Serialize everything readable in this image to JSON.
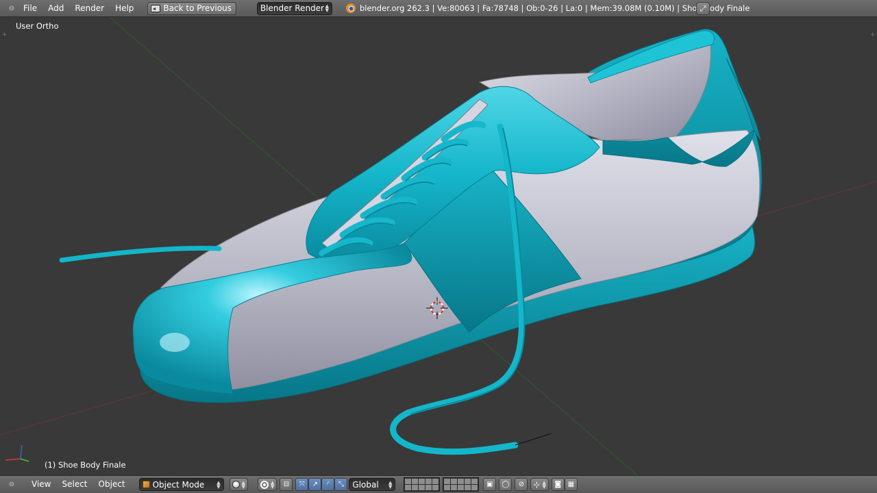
{
  "top_header": {
    "menus": [
      "File",
      "Add",
      "Render",
      "Help"
    ],
    "back_button_label": "Back to Previous",
    "render_engine": "Blender Render",
    "stats": "blender.org 262.3 | Ve:80063 | Fa:78748 | Ob:0-26 | La:0 | Mem:39.08M (0.10M) | Shoe Body Finale"
  },
  "viewport": {
    "view_name": "User Ortho",
    "active_object": "(1) Shoe Body Finale",
    "model_colors": {
      "accent": "#12b8cc",
      "accent_dark": "#0a8fa3",
      "panel": "#c9cad6",
      "lining": "#b8b8c8"
    }
  },
  "bottom_header": {
    "menus": [
      "View",
      "Select",
      "Object"
    ],
    "mode": "Object Mode",
    "orientation": "Global"
  },
  "icons": {
    "toggle": "header-toggle-icon",
    "blender": "blender-logo-icon",
    "fullscreen": "fullscreen-icon",
    "mode": "object-cube-icon",
    "shading": "solid-shading-icon",
    "pivot": "pivot-point-icon"
  }
}
